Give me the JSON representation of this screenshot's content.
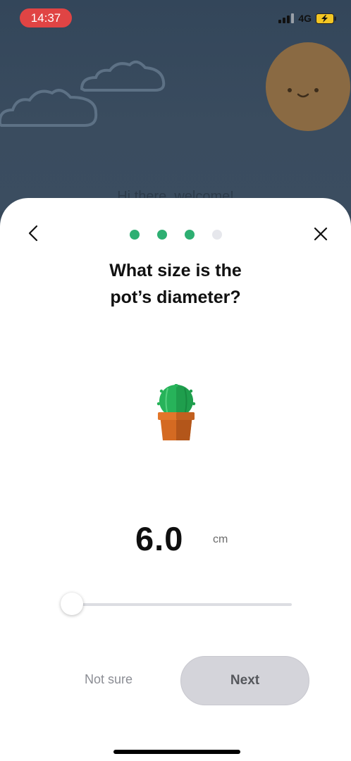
{
  "status_bar": {
    "time": "14:37",
    "network": "4G"
  },
  "background": {
    "greeting": "Hi there, welcome!"
  },
  "sheet": {
    "progress": {
      "total_steps": 4,
      "current_step": 3
    },
    "question_line1": "What size is the",
    "question_line2": "pot’s diameter?",
    "illustration": "potted-cactus",
    "value": "6.0",
    "unit": "cm",
    "slider_level": 0,
    "not_sure_label": "Not sure",
    "next_label": "Next"
  },
  "colors": {
    "accent_green": "#2eaf72",
    "inactive_dot": "#e6e7ec",
    "button_disabled": "#d4d4da",
    "status_pill": "#e04444"
  }
}
